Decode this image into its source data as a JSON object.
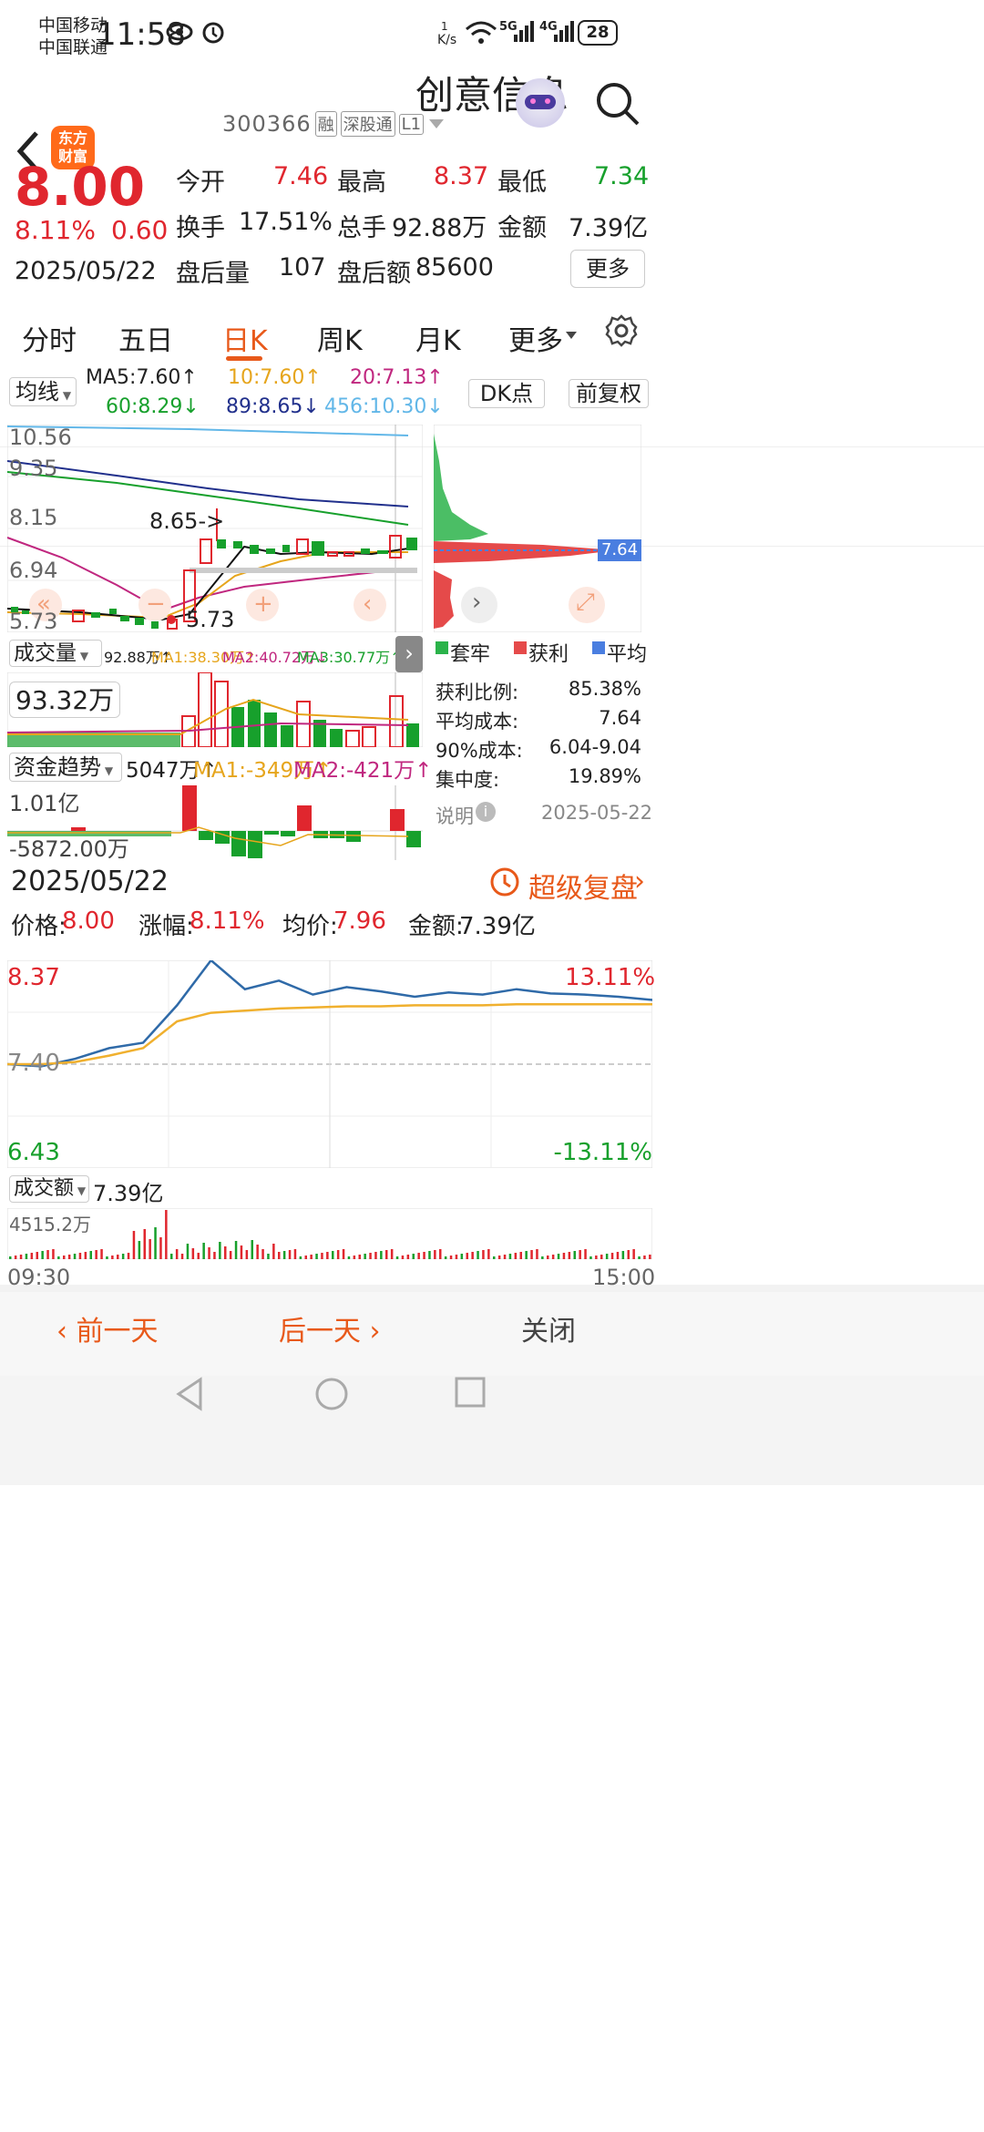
{
  "status": {
    "carrier1": "中国移动",
    "carrier2": "中国联通",
    "time": "11:58",
    "speed_top": "1",
    "speed_unit": "K/s",
    "net1": "5G",
    "net2": "4G",
    "battery": "28"
  },
  "header": {
    "title": "创意信息",
    "code": "300366",
    "tags": [
      "融",
      "深股通",
      "L1"
    ],
    "logo_line1": "东方",
    "logo_line2": "财富"
  },
  "quote": {
    "price": "8.00",
    "pct": "8.11%",
    "chg": "0.60",
    "date": "2025/05/22",
    "open_label": "今开",
    "open": "7.46",
    "high_label": "最高",
    "high": "8.37",
    "low_label": "最低",
    "low": "7.34",
    "turn_label": "换手",
    "turn": "17.51%",
    "vol_label": "总手",
    "vol": "92.88万",
    "amt_label": "金额",
    "amt": "7.39亿",
    "after_vol_label": "盘后量",
    "after_vol": "107",
    "after_amt_label": "盘后额",
    "after_amt": "85600",
    "more": "更多"
  },
  "tabs": [
    "分时",
    "五日",
    "日K",
    "周K",
    "月K",
    "更多"
  ],
  "kline": {
    "ma_select": "均线",
    "ma5": "MA5:7.60↑",
    "ma10": "10:7.60↑",
    "ma20": "20:7.13↑",
    "ma60": "60:8.29↓",
    "ma89": "89:8.65↓",
    "ma456": "456:10.30↓",
    "dk": "DK点",
    "fq": "前复权",
    "y_labels": [
      "10.56",
      "9.35",
      "8.15",
      "6.94",
      "5.73"
    ],
    "annot_high": "8.65->",
    "annot_low": "5.73",
    "vol_select": "成交量",
    "vol_vals": [
      "92.88万↑",
      "MA1:38.30万↑",
      "MA2:40.72万↓",
      "MA3:30.77万↑"
    ],
    "vol_label": "93.32万",
    "fund_select": "资金趋势",
    "fund_vals": [
      "5047万↑",
      "MA1:-349万↑",
      "MA2:-421万↑"
    ],
    "fund_top": "1.01亿",
    "fund_bot": "-5872.00万",
    "chip_price": "7.64",
    "chip_legend": [
      "套牢",
      "获利",
      "平均"
    ],
    "chip_stats": [
      {
        "k": "获利比例:",
        "v": "85.38%"
      },
      {
        "k": "平均成本:",
        "v": "7.64"
      },
      {
        "k": "90%成本:",
        "v": "6.04-9.04"
      },
      {
        "k": "集中度:",
        "v": "19.89%"
      }
    ],
    "chip_note": "说明",
    "chip_date": "2025-05-22"
  },
  "intraday": {
    "date": "2025/05/22",
    "replay": "超级复盘",
    "price_label": "价格:",
    "price": "8.00",
    "pct_label": "涨幅:",
    "pct": "8.11%",
    "avg_label": "均价:",
    "avg": "7.96",
    "amt_label": "金额:",
    "amt": "7.39亿",
    "y_top": "8.37",
    "y_mid": "7.40",
    "y_bot": "6.43",
    "r_top": "13.11%",
    "r_bot": "-13.11%",
    "amt_select": "成交额",
    "amt_total": "7.39亿",
    "vol_max": "4515.2万",
    "t_start": "09:30",
    "t_end": "15:00"
  },
  "bottom": {
    "prev": "前一天",
    "next": "后一天",
    "close": "关闭"
  },
  "colors": {
    "up": "#e0262e",
    "down": "#17a02c",
    "accent": "#e8591a",
    "brand": "#ff6a1a"
  },
  "chart_data": {
    "type": "line",
    "series": [
      {
        "name": "价格",
        "values": [
          7.4,
          7.38,
          7.45,
          7.55,
          7.6,
          7.95,
          8.37,
          8.1,
          8.18,
          8.05,
          8.12,
          8.08,
          8.03,
          8.07,
          8.05,
          8.1,
          8.06,
          8.05,
          8.03,
          8.0
        ]
      },
      {
        "name": "均价",
        "values": [
          7.4,
          7.4,
          7.42,
          7.48,
          7.55,
          7.8,
          7.88,
          7.9,
          7.92,
          7.93,
          7.94,
          7.94,
          7.95,
          7.95,
          7.95,
          7.96,
          7.96,
          7.96,
          7.96,
          7.96
        ]
      }
    ],
    "ylim": [
      6.43,
      8.37
    ]
  }
}
